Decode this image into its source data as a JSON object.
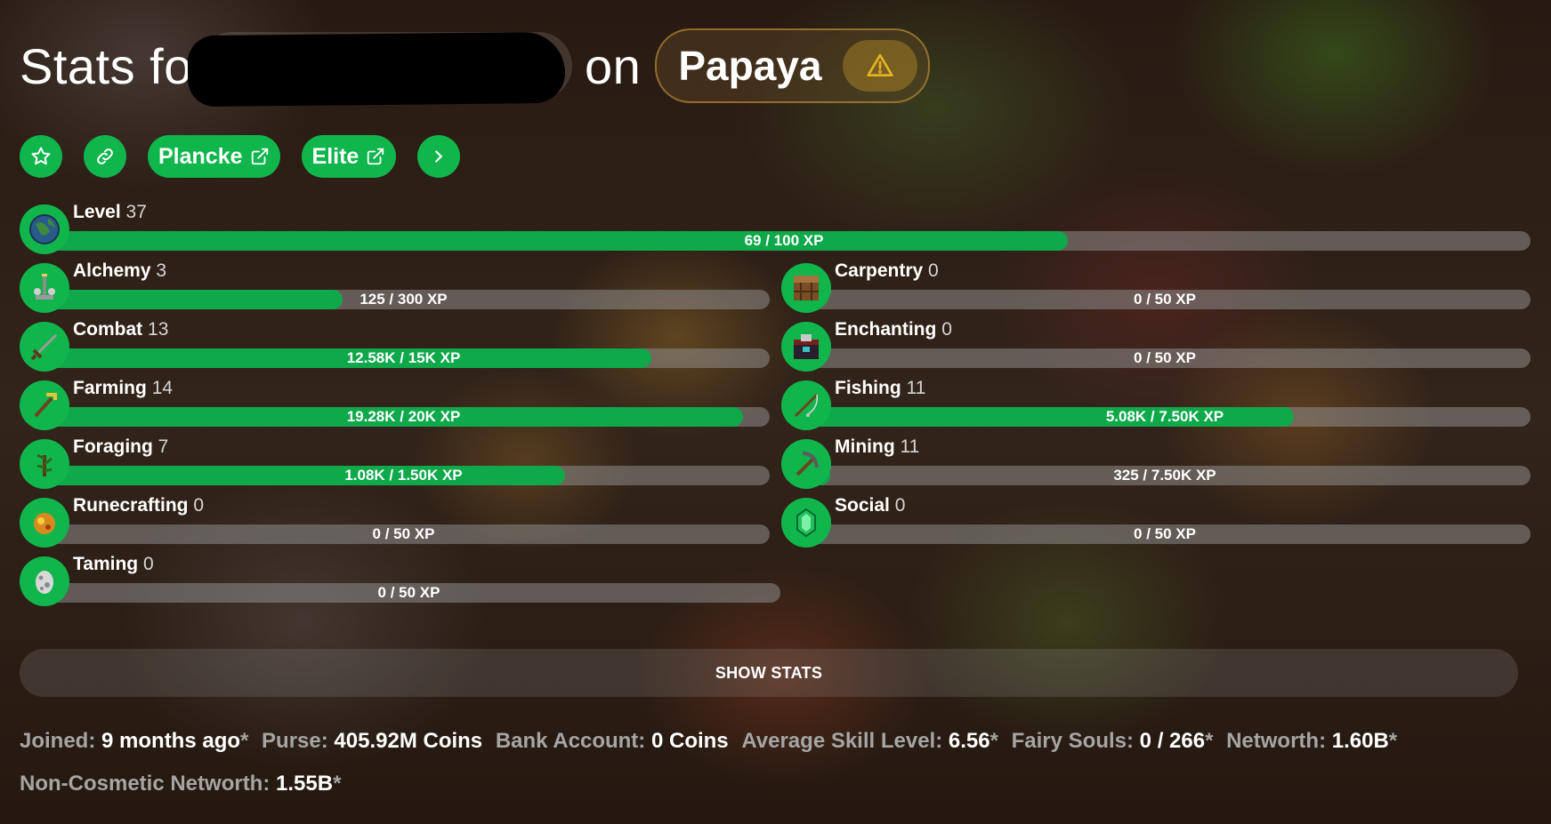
{
  "header": {
    "title_prefix": "Stats for",
    "title_on": "on",
    "profile_name": "Papaya"
  },
  "links": {
    "plancke": "Plancke",
    "elite": "Elite"
  },
  "level": {
    "name": "Level",
    "level": "37",
    "xp": "69 / 100 XP",
    "progress": 0.69
  },
  "skills": [
    {
      "name": "Alchemy",
      "level": "3",
      "xp": "125 / 300 XP",
      "progress": 0.417,
      "icon": "brewing-stand-icon"
    },
    {
      "name": "Carpentry",
      "level": "0",
      "xp": "0 / 50 XP",
      "progress": 0,
      "icon": "crafting-table-icon"
    },
    {
      "name": "Combat",
      "level": "13",
      "xp": "12.58K / 15K XP",
      "progress": 0.839,
      "icon": "sword-icon"
    },
    {
      "name": "Enchanting",
      "level": "0",
      "xp": "0 / 50 XP",
      "progress": 0,
      "icon": "enchanting-table-icon"
    },
    {
      "name": "Farming",
      "level": "14",
      "xp": "19.28K / 20K XP",
      "progress": 0.964,
      "icon": "hoe-icon"
    },
    {
      "name": "Fishing",
      "level": "11",
      "xp": "5.08K / 7.50K XP",
      "progress": 0.677,
      "icon": "fishing-rod-icon"
    },
    {
      "name": "Foraging",
      "level": "7",
      "xp": "1.08K / 1.50K XP",
      "progress": 0.72,
      "icon": "sapling-icon"
    },
    {
      "name": "Mining",
      "level": "11",
      "xp": "325 / 7.50K XP",
      "progress": 0.043,
      "icon": "pickaxe-icon"
    },
    {
      "name": "Runecrafting",
      "level": "0",
      "xp": "0 / 50 XP",
      "progress": 0,
      "icon": "magma-cream-icon"
    },
    {
      "name": "Social",
      "level": "0",
      "xp": "0 / 50 XP",
      "progress": 0,
      "icon": "emerald-icon"
    },
    {
      "name": "Taming",
      "level": "0",
      "xp": "0 / 50 XP",
      "progress": 0,
      "icon": "spawn-egg-icon"
    }
  ],
  "show_stats_label": "SHOW STATS",
  "info": {
    "joined_label": "Joined:",
    "joined_value": "9 months ago",
    "purse_label": "Purse:",
    "purse_value": "405.92M Coins",
    "bank_label": "Bank Account:",
    "bank_value": "0 Coins",
    "avg_skill_label": "Average Skill Level:",
    "avg_skill_value": "6.56",
    "fairy_label": "Fairy Souls:",
    "fairy_value": "0 / 266",
    "networth_label": "Networth:",
    "networth_value": "1.60B",
    "noncos_label": "Non-Cosmetic Networth:",
    "noncos_value": "1.55B",
    "asterisk": "*"
  },
  "colors": {
    "accent": "#10b54c",
    "bar_bg": "#8f8f8f",
    "warning": "#e6b422"
  }
}
